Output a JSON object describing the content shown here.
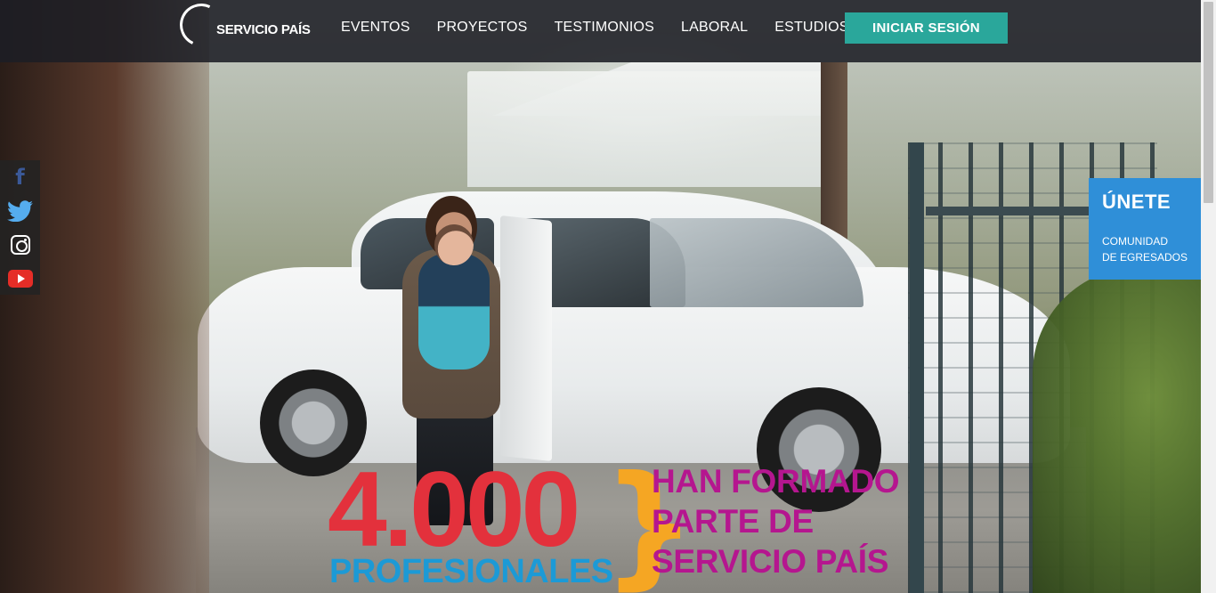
{
  "brand": {
    "logo_text": "SERVICIO PAÍS"
  },
  "nav": {
    "items": [
      {
        "label": "EVENTOS"
      },
      {
        "label": "PROYECTOS"
      },
      {
        "label": "TESTIMONIOS"
      },
      {
        "label": "LABORAL"
      },
      {
        "label": "ESTUDIOS"
      }
    ],
    "login_label": "INICIAR SESIÓN"
  },
  "social": {
    "items": [
      {
        "icon": "facebook-icon"
      },
      {
        "icon": "twitter-icon"
      },
      {
        "icon": "instagram-icon"
      },
      {
        "icon": "youtube-icon"
      }
    ]
  },
  "join_panel": {
    "title": "ÚNETE",
    "subtitle_line1": "COMUNIDAD",
    "subtitle_line2": "DE EGRESADOS"
  },
  "hero": {
    "big_number": "4.000",
    "professionals": "PROFESIONALES",
    "brace": "}",
    "phrase_line1": "HAN FORMADO",
    "phrase_line2": "PARTE DE",
    "phrase_line3": "SERVICIO PAÍS"
  },
  "colors": {
    "accent_teal": "#2aa79b",
    "join_blue": "#2f8fd8",
    "number_red": "#e3313c",
    "professionals_blue": "#1c9ad6",
    "brace_orange": "#f5a623",
    "phrase_magenta": "#b5168f"
  }
}
